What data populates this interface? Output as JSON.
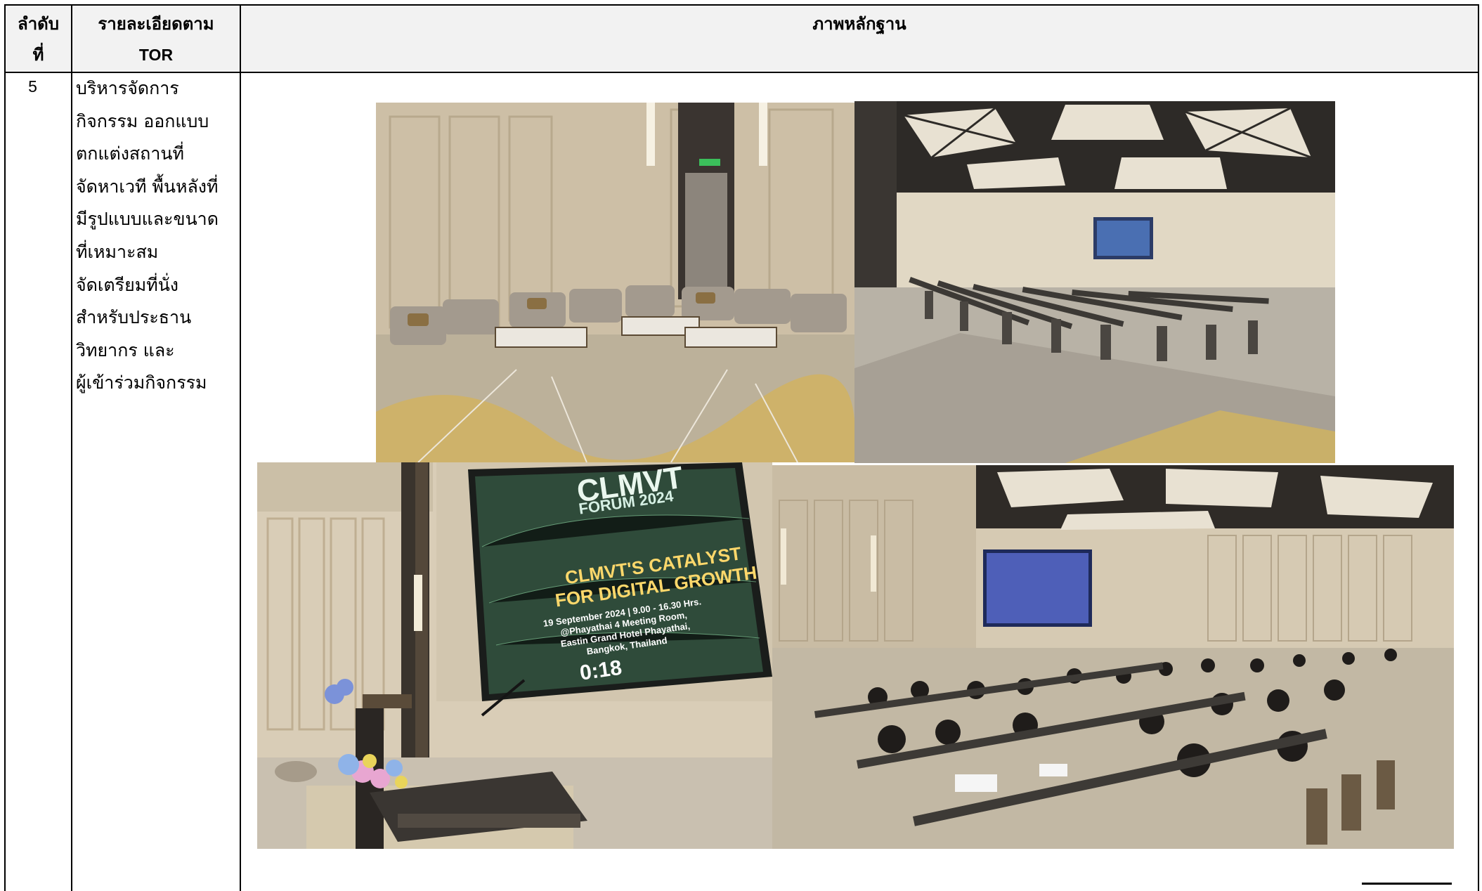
{
  "table": {
    "headers": {
      "col1_line1": "ลำดับ",
      "col1_line2": "ที่",
      "col2_line1": "รายละเอียดตาม",
      "col2_line2": "TOR",
      "col3": "ภาพหลักฐาน"
    },
    "row": {
      "number": "5",
      "description_lines": [
        "บริหารจัดการ",
        "กิจกรรม ออกแบบ",
        "ตกแต่งสถานที่",
        "จัดหาเวที พื้นหลังที่",
        "มีรูปแบบและขนาด",
        "ที่เหมาะสม",
        "จัดเตรียมที่นั่ง",
        "สำหรับประธาน",
        "วิทยากร และ",
        "ผู้เข้าร่วมกิจกรรม"
      ]
    }
  },
  "photos": {
    "screen": {
      "title": "CLMVT",
      "subtitle": "FORUM 2024",
      "catalyst_line1": "CLMVT'S CATALYST",
      "catalyst_line2": "FOR DIGITAL GROWTH",
      "details_line1": "19 September 2024 | 9.00 - 16.30 Hrs.",
      "details_line2": "@Phayathai 4 Meeting Room,",
      "details_line3": "Eastin Grand Hotel Phayathai,",
      "details_line4": "Bangkok, Thailand",
      "timer": "0:18"
    }
  },
  "colors": {
    "header_bg": "#f2f2f2",
    "border": "#000000",
    "wall": "#cfc3ad",
    "carpet": "#bfae84",
    "screen_bg": "#2f4b3a"
  }
}
